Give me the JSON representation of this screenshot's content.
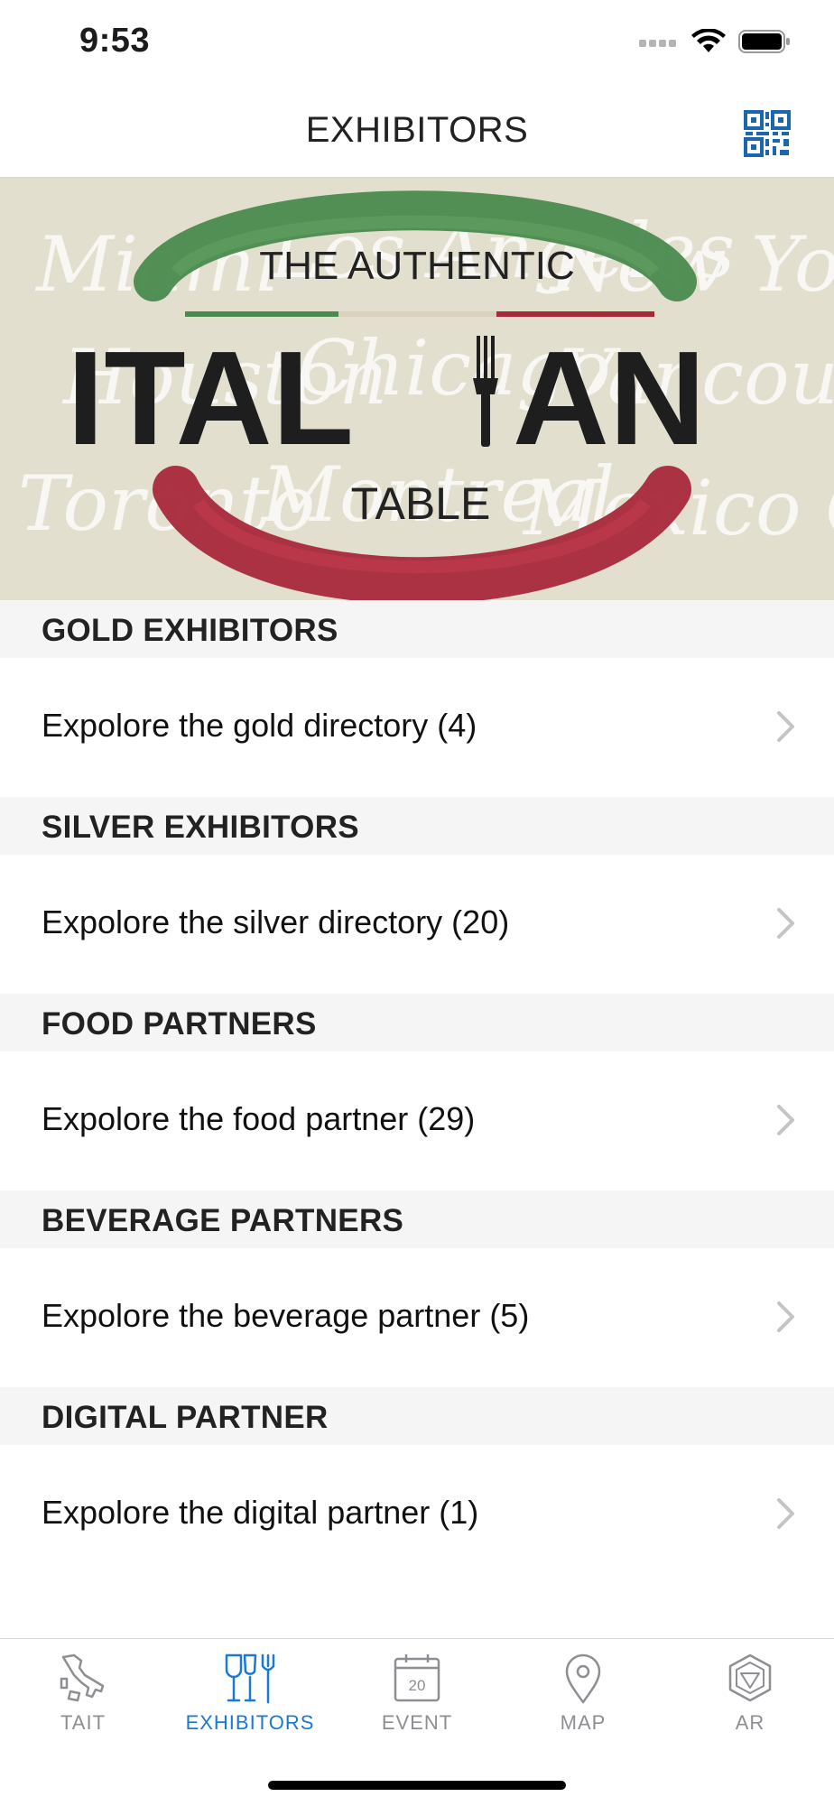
{
  "status_bar": {
    "time": "9:53"
  },
  "nav": {
    "title": "EXHIBITORS"
  },
  "banner": {
    "line1": "THE AUTHENTIC",
    "line2_left": "ITAL",
    "line2_right": "AN",
    "line3": "TABLE",
    "background_cities": [
      "Miami",
      "Los Angeles",
      "New York",
      "Houston",
      "Chicago",
      "Vancouver",
      "Toronto",
      "Montreal",
      "Mexico City"
    ],
    "colors": {
      "green": "#4a8a4e",
      "red": "#a8283a",
      "cream": "#e3dfcf"
    }
  },
  "sections": [
    {
      "header": "GOLD EXHIBITORS",
      "row": "Expolore the gold directory (4)"
    },
    {
      "header": "SILVER EXHIBITORS",
      "row": "Expolore the silver directory (20)"
    },
    {
      "header": "FOOD PARTNERS",
      "row": "Expolore the food partner (29)"
    },
    {
      "header": "BEVERAGE PARTNERS",
      "row": "Expolore the beverage partner (5)"
    },
    {
      "header": "DIGITAL PARTNER",
      "row": "Expolore the digital partner (1)"
    }
  ],
  "tabs": [
    {
      "label": "TAIT",
      "icon": "italy-map-icon"
    },
    {
      "label": "EXHIBITORS",
      "icon": "glasses-cutlery-icon",
      "active": true
    },
    {
      "label": "EVENT",
      "icon": "calendar-icon",
      "calendar_day": "20"
    },
    {
      "label": "MAP",
      "icon": "map-pin-icon"
    },
    {
      "label": "AR",
      "icon": "ar-cube-icon"
    }
  ],
  "colors": {
    "accent": "#1a78d6",
    "inactive": "#8e8e93",
    "section_bg": "#f5f5f5"
  }
}
